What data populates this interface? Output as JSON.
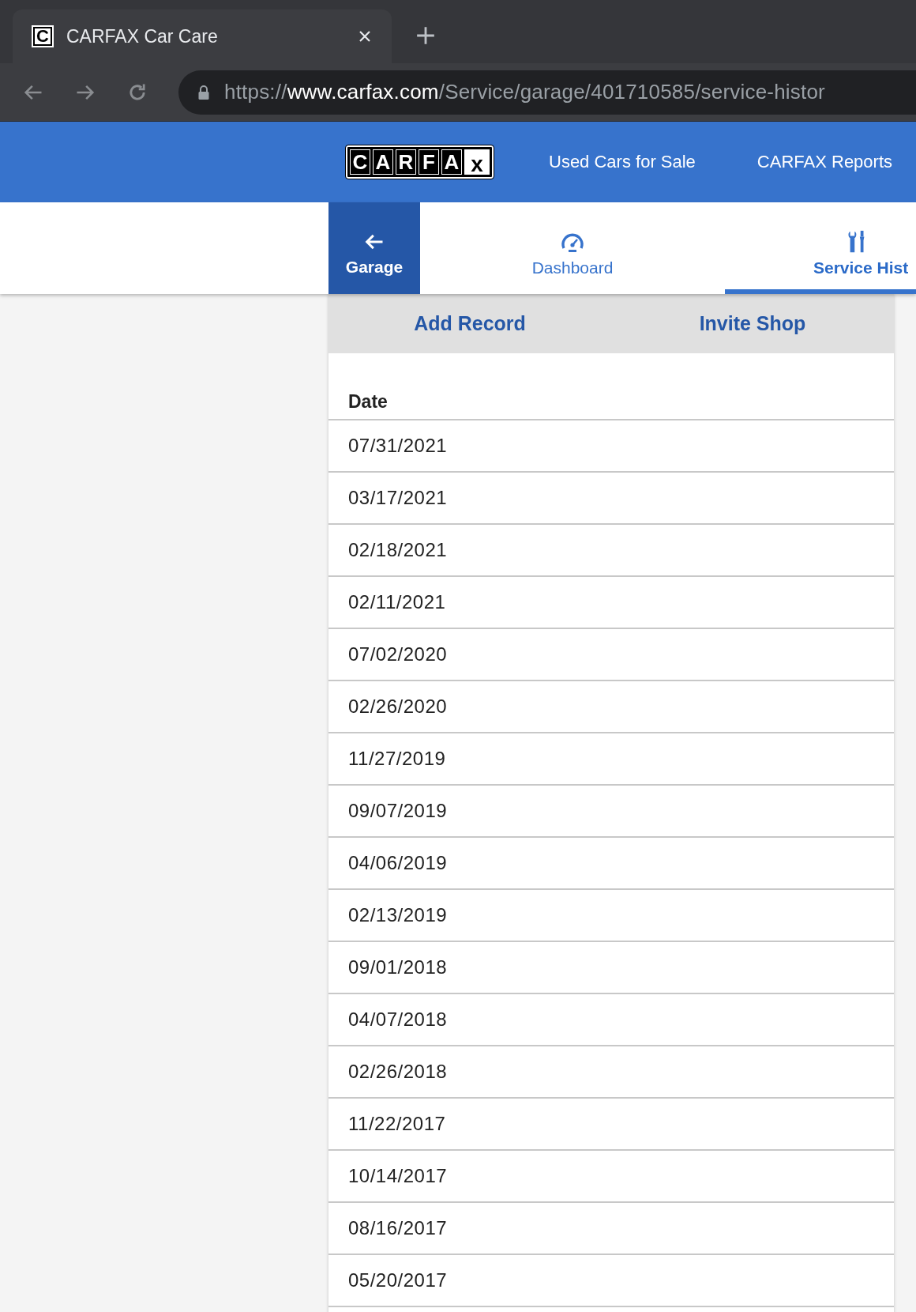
{
  "browser": {
    "favicon": "C",
    "tab_title": "CARFAX Car Care",
    "url": {
      "scheme": "https://",
      "host": "www.carfax.com",
      "path": "/Service/garage/401710585/service-histor"
    }
  },
  "header": {
    "logo_letters": [
      "C",
      "A",
      "R",
      "F",
      "A",
      "x"
    ],
    "nav_links": [
      "Used Cars for Sale",
      "CARFAX Reports"
    ]
  },
  "back_button": {
    "label": "Garage"
  },
  "tabs": [
    {
      "kind": "dashboard",
      "label": "Dashboard",
      "selected": false
    },
    {
      "kind": "service",
      "label": "Service Hist",
      "selected": true
    }
  ],
  "actions": [
    "Add Record",
    "Invite Shop"
  ],
  "table": {
    "columns": [
      "Date"
    ],
    "rows": [
      "07/31/2021",
      "03/17/2021",
      "02/18/2021",
      "02/11/2021",
      "07/02/2020",
      "02/26/2020",
      "11/27/2019",
      "09/07/2019",
      "04/06/2019",
      "02/13/2019",
      "09/01/2018",
      "04/07/2018",
      "02/26/2018",
      "11/22/2017",
      "10/14/2017",
      "08/16/2017",
      "05/20/2017"
    ]
  }
}
